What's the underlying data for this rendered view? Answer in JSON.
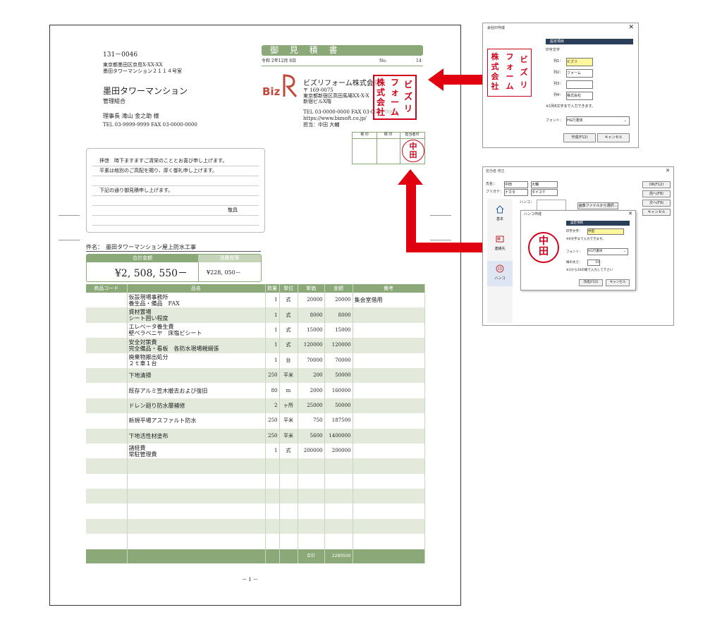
{
  "doc": {
    "recipient": {
      "postal": "131－0046",
      "addr1": "東京都墨田区京島X-XX-XX",
      "addr2": "墨田タワーマンション２１１４号室",
      "name": "墨田タワーマンション",
      "org": "管理組合",
      "person": "理事長 滝山 金之助 様",
      "tel": "TEL 03-9999-9999 FAX 03-0000-0000"
    },
    "title": "御 見 積 書",
    "date": "令和 2年12月 8日",
    "no_label": "No.",
    "no_value": "14",
    "company": {
      "logo_text": "Biz",
      "name": "ビズリフォーム株式会社",
      "postal": "〒 169-0075",
      "addr1": "東京都新宿区高田馬場XX-X-X",
      "addr2": "新宿ビルX階",
      "tel": "TEL 03-0000-0000 FAX 03-0000-0001",
      "url": "https://www.bizsoft.co.jp/",
      "rep": "担当：中田 大輔"
    },
    "company_stamp": [
      "株",
      "式",
      "会",
      "社",
      "フ",
      "ォ",
      "ー",
      "ム",
      "ビ",
      "ズ",
      "リ"
    ],
    "approval_headers": [
      "検 印",
      "検 印",
      "担当者印"
    ],
    "person_stamp": [
      "中",
      "田"
    ],
    "greetings": [
      "拝啓　時下ますますご清栄のこととお喜び申し上げます。",
      "平素は格別のご高配を賜り、厚く御礼申し上げます。",
      "",
      "下記の通り御見積申し上げます。",
      "",
      "敬具"
    ],
    "subject_label": "件名：",
    "subject": "墨田タワーマンション屋上防水工事",
    "total_label": "合計金額",
    "tax_label": "消費税等",
    "total_value": "¥2, 508, 550－",
    "tax_value": "¥228, 050－",
    "table_headers": [
      "商品コード",
      "品名",
      "数量",
      "単位",
      "単価",
      "金額",
      "備考"
    ],
    "items": [
      {
        "name1": "仮設現場事務所",
        "name2": "養生品・備品　FAX",
        "qty": "1",
        "unit": "式",
        "price": "20000",
        "amount": "20000",
        "note": "集会室借用"
      },
      {
        "name1": "資材置場",
        "name2": "シート囲い程度",
        "qty": "1",
        "unit": "式",
        "price": "8000",
        "amount": "8000",
        "note": ""
      },
      {
        "name1": "エレベータ養生費",
        "name2": "壁ベラベニヤ　床塩ビシート",
        "qty": "1",
        "unit": "式",
        "price": "15000",
        "amount": "15000",
        "note": ""
      },
      {
        "name1": "安全対策費",
        "name2": "完全備品・看板　各防水現場親綱張",
        "qty": "1",
        "unit": "式",
        "price": "120000",
        "amount": "120000",
        "note": ""
      },
      {
        "name1": "廃棄物搬出処分",
        "name2": "２ｔ車１台",
        "qty": "1",
        "unit": "台",
        "price": "70000",
        "amount": "70000",
        "note": ""
      },
      {
        "name1": "下地清掃",
        "name2": "",
        "qty": "250",
        "unit": "平米",
        "price": "200",
        "amount": "50000",
        "note": ""
      },
      {
        "name1": "既存アルミ笠木撤去および復旧",
        "name2": "",
        "qty": "80",
        "unit": "m",
        "price": "2000",
        "amount": "160000",
        "note": ""
      },
      {
        "name1": "ドレン廻り防水層補修",
        "name2": "",
        "qty": "2",
        "unit": "ヶ所",
        "price": "25000",
        "amount": "50000",
        "note": ""
      },
      {
        "name1": "新規平場アスファルト防水",
        "name2": "",
        "qty": "250",
        "unit": "平米",
        "price": "750",
        "amount": "187500",
        "note": ""
      },
      {
        "name1": "下地活性材塗布",
        "name2": "",
        "qty": "250",
        "unit": "平米",
        "price": "5600",
        "amount": "1400000",
        "note": ""
      },
      {
        "name1": "諸経費",
        "name2": "常駐管理費",
        "qty": "1",
        "unit": "式",
        "price": "200000",
        "amount": "200000",
        "note": ""
      }
    ],
    "sum_label": "合計",
    "sum_value": "2280500",
    "page_number": "－ 1 －"
  },
  "dialog1": {
    "title": "会社印作成",
    "section": "設定項目",
    "field_label": "印字文字",
    "col_labels": [
      "列1：",
      "列2：",
      "列3：",
      "列4："
    ],
    "col_values": [
      "ビズリ",
      "フォーム",
      "",
      "株式会社"
    ],
    "note": "※1列6文字まで入力できます。",
    "font_label": "フォント：",
    "font_value": "HG行書体",
    "create_btn": "作成(F12)",
    "cancel_btn": "キャンセル",
    "stamp_cols": [
      "株式会社",
      "フォーム",
      "ビズリ"
    ]
  },
  "dialog2": {
    "title": "担当者 修正",
    "name_label": "氏名：",
    "name_last": "中田",
    "name_first": "大輔",
    "kana_label": "フリガナ：",
    "kana_last": "ナカタ",
    "kana_first": "ダイスケ",
    "hanko_label": "ハンコ：",
    "image_btn": "画像ファイルから選択...",
    "side_buttons": [
      "OK(F12)",
      "前へ(F8)",
      "次へ(F9)",
      "キャンセル"
    ],
    "nav": [
      {
        "icon": "home-icon",
        "label": "基本"
      },
      {
        "icon": "contact-icon",
        "label": "連絡先"
      },
      {
        "icon": "stamp-icon",
        "label": "ハンコ"
      }
    ]
  },
  "dialog3": {
    "title": "ハンコ作成",
    "section": "設定項目",
    "field_label": "印字文字：",
    "field_value": "中田",
    "note1": "※6文字まで入力できます。",
    "font_label": "フォント：",
    "font_value": "HG行書体",
    "size_label": "線の太さ：",
    "size_value": "10",
    "note2": "※1から20の間で入力して下さい",
    "create_btn": "作成(F12)",
    "cancel_btn": "キャンセル",
    "stamp_chars": [
      "中",
      "田"
    ]
  }
}
